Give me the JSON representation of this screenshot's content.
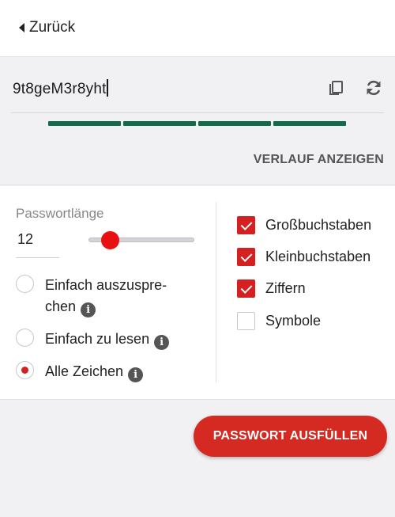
{
  "header": {
    "back_label": "Zurück"
  },
  "password": {
    "value": "9t8geM3r8yht",
    "strength_segments": 4,
    "strength_color": "#0f6b49"
  },
  "history_button": "VERLAUF ANZEIGEN",
  "options": {
    "length_label": "Passwortlänge",
    "length_value": "12",
    "slider_accent": "#e81010",
    "radios": [
      {
        "line1": "Einfach auszuspre-",
        "line2": "chen",
        "checked": false,
        "info_icon": "info-icon"
      },
      {
        "label": "Einfach zu lesen",
        "checked": false,
        "info_icon": "info-icon"
      },
      {
        "label": "Alle Zeichen",
        "checked": true,
        "info_icon": "info-icon"
      }
    ],
    "checkboxes": [
      {
        "label": "Großbuchstaben",
        "checked": true
      },
      {
        "label": "Kleinbuchstaben",
        "checked": true
      },
      {
        "label": "Ziffern",
        "checked": true
      },
      {
        "label": "Symbole",
        "checked": false
      }
    ]
  },
  "fill_button": "PASSWORT AUSFÜLLEN",
  "accent_color": "#d42a22",
  "icons": {
    "back": "caret-left-icon",
    "copy": "copy-icon",
    "refresh": "refresh-icon",
    "info": "info-icon"
  }
}
